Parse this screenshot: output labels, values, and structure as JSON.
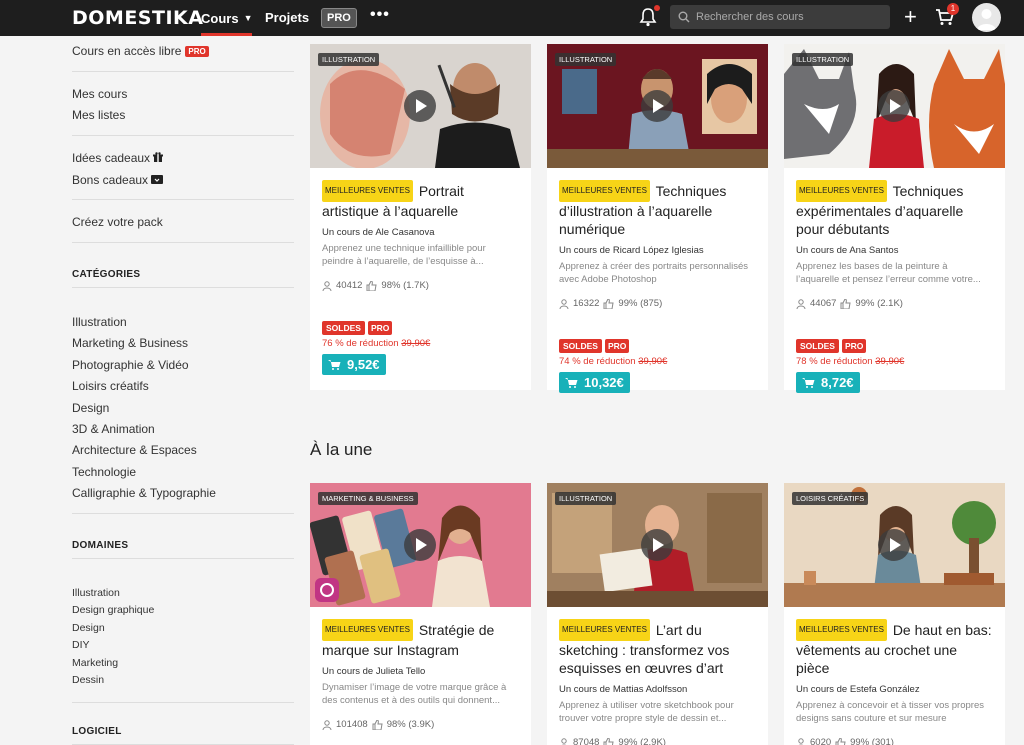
{
  "header": {
    "logo": "DOMESTIKA",
    "nav_cours": "Cours",
    "nav_projets": "Projets",
    "nav_pro": "PRO",
    "search_placeholder": "Rechercher des cours",
    "cart_count": "1"
  },
  "sidebar": {
    "libre": "Cours en accès libre",
    "libre_badge": "PRO",
    "mes_cours": "Mes cours",
    "mes_listes": "Mes listes",
    "idees": "Idées cadeaux",
    "bons": "Bons cadeaux",
    "pack": "Créez votre pack",
    "categories_heading": "CATÉGORIES",
    "categories": [
      "Illustration",
      "Marketing & Business",
      "Photographie & Vidéo",
      "Loisirs créatifs",
      "Design",
      "3D & Animation",
      "Architecture & Espaces",
      "Technologie",
      "Calligraphie & Typographie"
    ],
    "domaines_heading": "DOMAINES",
    "domaines": [
      "Illustration",
      "Design graphique",
      "Design",
      "DIY",
      "Marketing",
      "Dessin"
    ],
    "logiciel_heading": "LOGICIEL"
  },
  "section_title": "À la une",
  "cards": [
    {
      "category": "ILLUSTRATION",
      "badge": "MEILLEURES VENTES",
      "title": "Portrait artistique à l’aquarelle",
      "author": "Un cours de Ale Casanova",
      "desc": "Apprenez une technique infaillible pour peindre à l’aquarelle, de l’esquisse à...",
      "students": "40412",
      "rating": "98% (1.7K)",
      "soldes": "SOLDES",
      "pro": "PRO",
      "discount": "76 % de réduction",
      "old_price": "39,90€",
      "price": "9,52€"
    },
    {
      "category": "ILLUSTRATION",
      "badge": "MEILLEURES VENTES",
      "title": "Techniques d’illustration à l’aquarelle numérique",
      "author": "Un cours de Ricard López Iglesias",
      "desc": "Apprenez à créer des portraits personnalisés avec Adobe Photoshop",
      "students": "16322",
      "rating": "99% (875)",
      "soldes": "SOLDES",
      "pro": "PRO",
      "discount": "74 % de réduction",
      "old_price": "39,90€",
      "price": "10,32€"
    },
    {
      "category": "ILLUSTRATION",
      "badge": "MEILLEURES VENTES",
      "title": "Techniques expérimentales d’aquarelle pour débutants",
      "author": "Un cours de Ana Santos",
      "desc": "Apprenez les bases de la peinture à l’aquarelle et pensez l’erreur comme votre...",
      "students": "44067",
      "rating": "99% (2.1K)",
      "soldes": "SOLDES",
      "pro": "PRO",
      "discount": "78 % de réduction",
      "old_price": "39,90€",
      "price": "8,72€"
    },
    {
      "category": "MARKETING & BUSINESS",
      "badge": "MEILLEURES VENTES",
      "title": "Stratégie de marque sur Instagram",
      "author": "Un cours de Julieta Tello",
      "desc": "Dynamiser l’image de votre marque grâce à des contenus et à des outils qui donnent...",
      "students": "101408",
      "rating": "98% (3.9K)"
    },
    {
      "category": "ILLUSTRATION",
      "badge": "MEILLEURES VENTES",
      "title": "L’art du sketching : transformez vos esquisses en œuvres d’art",
      "author": "Un cours de Mattias Adolfsson",
      "desc": "Apprenez à utiliser votre sketchbook pour trouver votre propre style de dessin et...",
      "students": "87048",
      "rating": "99% (2.9K)"
    },
    {
      "category": "LOISIRS CRÉATIFS",
      "badge": "MEILLEURES VENTES",
      "title": "De haut en bas: vêtements au crochet une pièce",
      "author": "Un cours de Estefa González",
      "desc": "Apprenez à concevoir et à tisser vos propres designs sans couture et sur mesure",
      "students": "6020",
      "rating": "99% (301)"
    }
  ]
}
